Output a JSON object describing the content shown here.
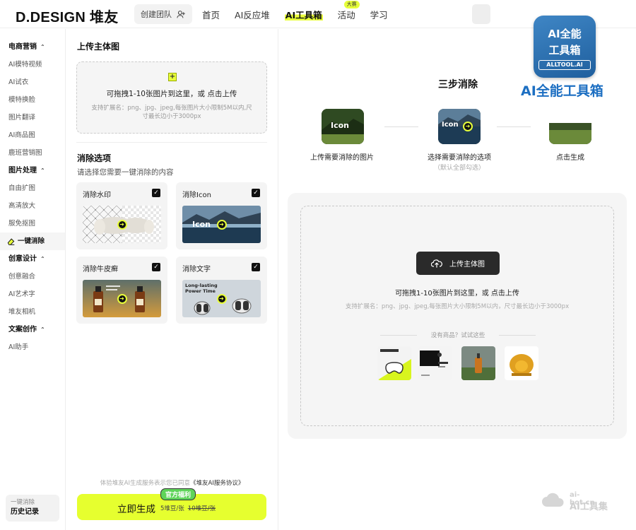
{
  "header": {
    "logo": "D.DESIGN 堆友",
    "team_button": "创建团队",
    "nav": [
      {
        "label": "首页"
      },
      {
        "label": "AI反应堆"
      },
      {
        "label": "AI工具箱",
        "active": true
      },
      {
        "label": "活动",
        "badge": "大赛"
      },
      {
        "label": "学习"
      }
    ]
  },
  "sidebar": {
    "groups": [
      {
        "title": "电商营销",
        "items": [
          "AI模特视频",
          "AI试衣",
          "模特换脸",
          "图片翻译",
          "AI商品图",
          "鹿班营销图"
        ]
      },
      {
        "title": "图片处理",
        "items": [
          "自由扩图",
          "高清放大",
          "服免抠图",
          "一键消除"
        ],
        "active": "一键消除"
      },
      {
        "title": "创意设计",
        "items": [
          "创意融合",
          "AI艺术字",
          "堆友相机"
        ]
      },
      {
        "title": "文案创作",
        "items": [
          "AI助手"
        ]
      }
    ],
    "history_caption": "一键消除",
    "history_label": "历史记录"
  },
  "upload": {
    "title": "上传主体图",
    "main_text": "可拖拽1-10张图片到这里，或 点击上传",
    "sub_text": "支持扩展名：png、jpg、jpeg,每张图片大小限制5M以内,尺寸最长边小于3000px"
  },
  "options": {
    "title": "消除选项",
    "subtitle": "请选择您需要一键消除的内容",
    "cards": [
      {
        "label": "消除水印",
        "checked": true
      },
      {
        "label": "消除Icon",
        "checked": true,
        "image_text": "Icon"
      },
      {
        "label": "消除牛皮癣",
        "checked": true
      },
      {
        "label": "消除文字",
        "checked": true,
        "image_text": "Long-lasting Power Time"
      }
    ]
  },
  "footer": {
    "agree_prefix": "体验堆友AI生成服务表示您已同意",
    "agree_link": "《堆友AI服务协议》",
    "generate_label": "立即生成",
    "tag": "官方福利",
    "price": "5堆豆/张",
    "old_price": "10堆豆/张"
  },
  "steps": {
    "title": "三步消除",
    "items": [
      {
        "label": "上传需要消除的图片",
        "image_text": "Icon"
      },
      {
        "label": "选择需要消除的选项",
        "sub": "（默认全部勾选）",
        "image_text": "Icon"
      },
      {
        "label": "点击生成"
      }
    ]
  },
  "upload_panel": {
    "button": "上传主体图",
    "main_text": "可拖拽1-10张图片到这里，或 点击上传",
    "sub_text": "支持扩展名：png、jpg、jpeg,每张图片大小限制5M以内，尺寸最长边小于3000px",
    "try_text": "没有商品？试试这些"
  },
  "badge": {
    "line1": "AI全能",
    "line2": "工具箱",
    "line3": "ALLTOOL.AI",
    "caption": "AI全能工具箱"
  },
  "watermark": {
    "line1": "ai-bot.cn",
    "line2": "AI工具集"
  },
  "colors": {
    "accent": "#e6ff2f",
    "dark": "#2a2a2a",
    "badge_blue": "#1d6fc2"
  }
}
